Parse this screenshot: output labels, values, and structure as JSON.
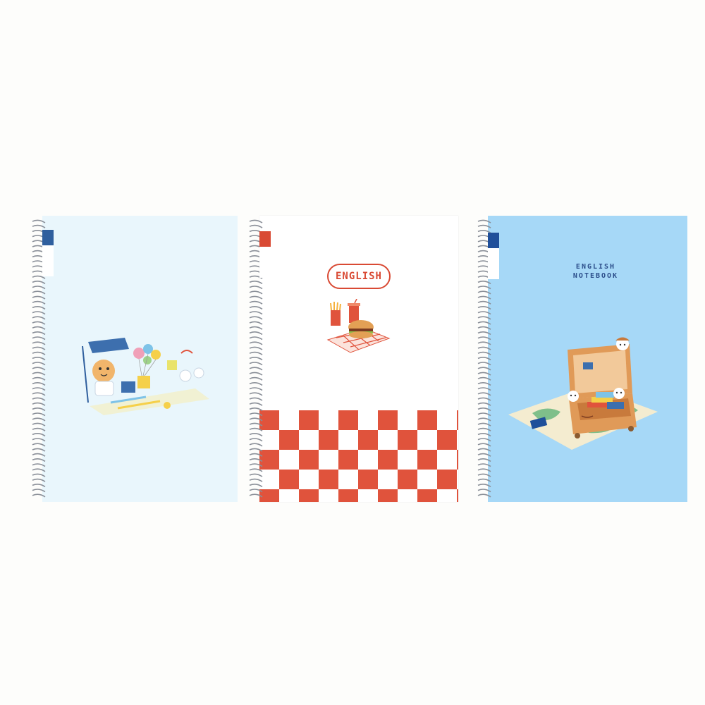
{
  "colors": {
    "background": "#fdfdfb",
    "cover_left": "#e9f6fc",
    "cover_middle": "#ffffff",
    "cover_right": "#a6d8f7",
    "checker_red": "#e0533c",
    "spiral": "#8a8f98",
    "tab_blue": "#2f5f9e",
    "tab_red": "#d94a34",
    "tab_navy": "#1f4f9a"
  },
  "notebooks": [
    {
      "name": "left-notebook",
      "illustration": "doodle-parade-illustration",
      "tabs": [
        "",
        "",
        ""
      ],
      "brand": "",
      "title": ""
    },
    {
      "name": "middle-notebook",
      "illustration": "fast-food-picnic-illustration",
      "tabs": [
        "",
        "",
        ""
      ],
      "brand": "",
      "title": "ENGLISH"
    },
    {
      "name": "right-notebook",
      "illustration": "suitcase-map-illustration",
      "tabs": [
        "",
        "",
        ""
      ],
      "brand": "",
      "title_line1": "ENGLISH",
      "title_line2": "NOTEBOOK"
    }
  ]
}
